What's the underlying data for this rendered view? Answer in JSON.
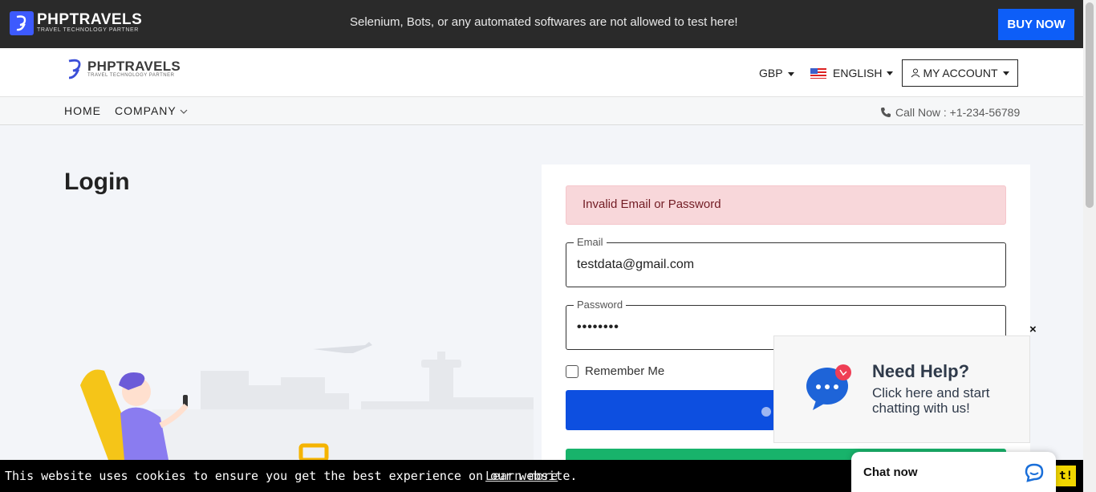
{
  "topbar": {
    "brand": "PHPTRAVELS",
    "tagline": "TRAVEL TECHNOLOGY PARTNER",
    "notice": "Selenium, Bots, or any automated softwares are not allowed to test here!",
    "buy_label": "BUY NOW"
  },
  "nav": {
    "brand": "PHPTRAVELS",
    "tagline": "TRAVEL TECHNOLOGY PARTNER",
    "currency": "GBP",
    "language": "ENGLISH",
    "account": "MY ACCOUNT"
  },
  "subnav": {
    "home": "HOME",
    "company": "COMPANY",
    "call": "Call Now : +1-234-56789"
  },
  "page": {
    "title": "Login"
  },
  "form": {
    "alert": "Invalid Email or Password",
    "email_label": "Email",
    "email_value": "testdata@gmail.com",
    "password_label": "Password",
    "password_value": "••••••••",
    "remember_label": "Remember Me"
  },
  "help": {
    "title": "Need Help?",
    "subtitle": "Click here and start chatting with us!",
    "close": "×"
  },
  "cookie": {
    "message": "This website uses cookies to ensure you get the best experience on our website.",
    "learn_more": "Learn more",
    "accept": "t!"
  },
  "chat": {
    "label": "Chat now"
  },
  "colors": {
    "primary": "#0d4fe0",
    "buy_now": "#0d5ef8",
    "signup": "#18b36b",
    "alert_bg": "#f8d7da",
    "topbar": "#2a2a2a"
  }
}
